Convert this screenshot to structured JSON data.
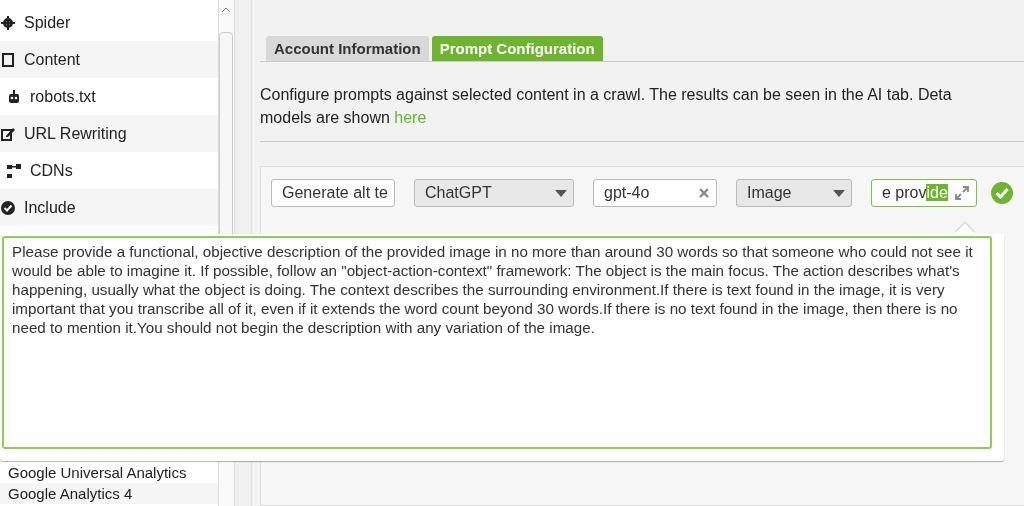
{
  "sidebar": {
    "items": [
      {
        "label": "Spider"
      },
      {
        "label": "Content"
      },
      {
        "label": "robots.txt"
      },
      {
        "label": "URL Rewriting"
      },
      {
        "label": "CDNs"
      },
      {
        "label": "Include"
      }
    ],
    "lower_items": [
      {
        "label": "Google Universal Analytics"
      },
      {
        "label": "Google Analytics 4"
      }
    ]
  },
  "tabs": [
    {
      "label": "Account Information",
      "selected": false
    },
    {
      "label": "Prompt Configuration",
      "selected": true
    }
  ],
  "description": {
    "text": "Configure prompts against selected content in a crawl. The results can be seen in the AI tab. Deta",
    "text_line2": "models are shown",
    "link": "here"
  },
  "prompt_row": {
    "name": "Generate alt te",
    "provider": "ChatGPT",
    "model": "gpt-4o",
    "content_type": "Image",
    "prompt_before": "e prov",
    "prompt_selected": "ide",
    "valid": true
  },
  "prompt_editor": {
    "text": "Please provide a functional, objective description of the provided image in no more than around 30 words so that someone who could not see it would be able to imagine it. If possible, follow an \"object-action-context\" framework: The object is the main focus. The action describes what's happening, usually what the object is doing. The context describes the surrounding environment.If there is text found in the image, it is very important that you transcribe all of it, even if it extends the word count beyond 30 words.If there is no text found in the image, then there is no need to mention it.You should not begin the description with any variation of the image."
  }
}
